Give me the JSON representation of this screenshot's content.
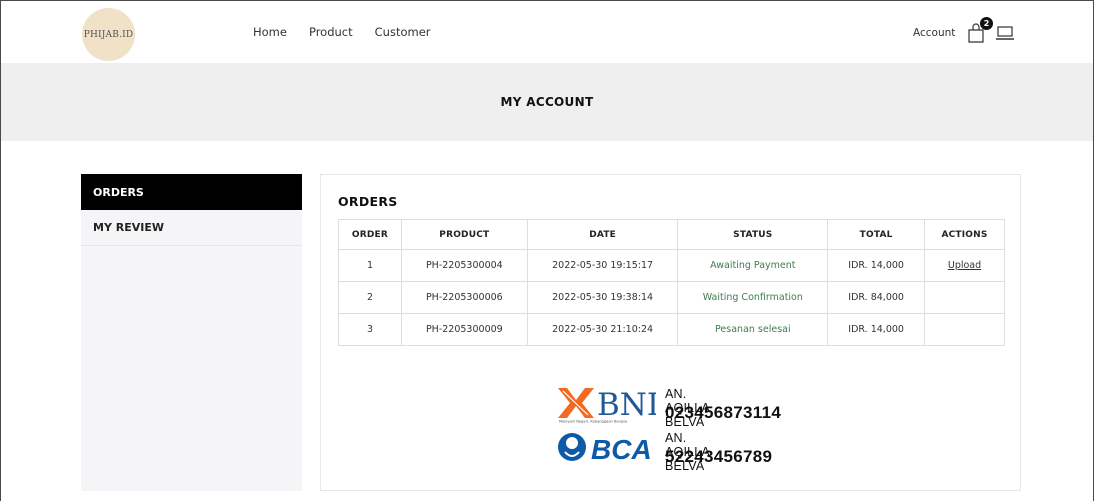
{
  "header": {
    "logo_text": "PHIJAB.ID",
    "nav": [
      "Home",
      "Product",
      "Customer"
    ],
    "account_label": "Account",
    "cart_count": "2"
  },
  "banner": {
    "title": "MY ACCOUNT"
  },
  "sidebar": {
    "items": [
      {
        "label": "ORDERS",
        "active": true
      },
      {
        "label": "MY REVIEW",
        "active": false
      }
    ]
  },
  "orders": {
    "title": "ORDERS",
    "columns": [
      "ORDER",
      "PRODUCT",
      "DATE",
      "STATUS",
      "TOTAL",
      "ACTIONS"
    ],
    "rows": [
      {
        "order": "1",
        "product": "PH-2205300004",
        "date": "2022-05-30 19:15:17",
        "status": "Awaiting Payment",
        "total": "IDR. 14,000",
        "action": "Upload"
      },
      {
        "order": "2",
        "product": "PH-2205300006",
        "date": "2022-05-30 19:38:14",
        "status": "Waiting Confirmation",
        "total": "IDR. 84,000",
        "action": ""
      },
      {
        "order": "3",
        "product": "PH-2205300009",
        "date": "2022-05-30 21:10:24",
        "status": "Pesanan selesai",
        "total": "IDR. 14,000",
        "action": ""
      }
    ]
  },
  "payment": {
    "bni": {
      "brand": "BNI",
      "tagline": "Melayani Negeri, Kebanggaan Bangsa",
      "account_name": "AN. AQILLA BELVA",
      "account_number": "023456873114"
    },
    "bca": {
      "brand": "BCA",
      "account_name": "AN. AQILLA BELVA",
      "account_number": "52243456789"
    }
  },
  "colors": {
    "status_text": "#3f7d4f",
    "bni_orange": "#f26a21",
    "bni_blue": "#1f5a96",
    "bca_blue": "#0d5aa7",
    "logo_bg": "#f1e1c7"
  }
}
